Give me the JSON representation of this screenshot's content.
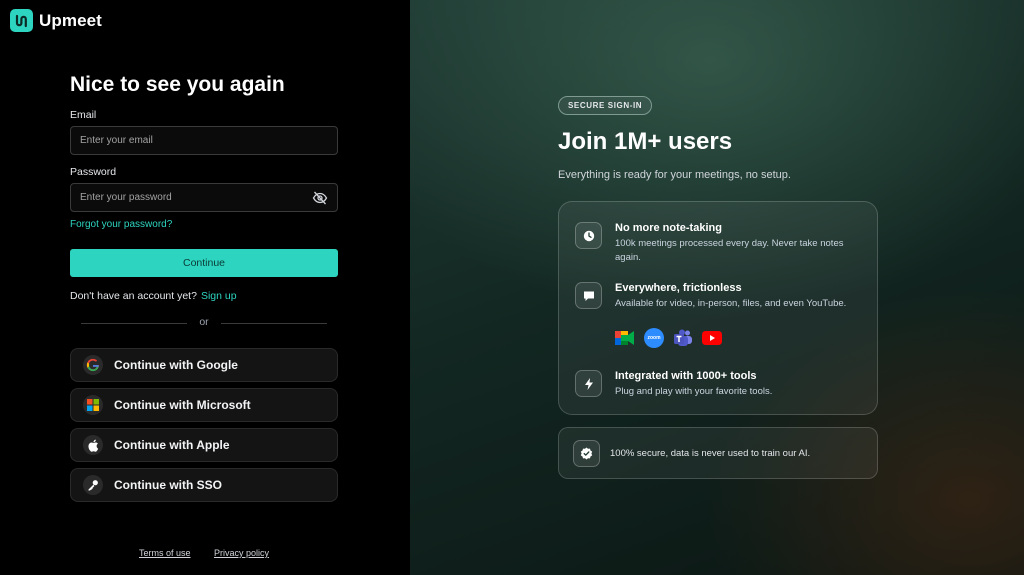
{
  "brand": {
    "name": "Upmeet",
    "accent": "#2dd4bf"
  },
  "login": {
    "title": "Nice to see you again",
    "email_label": "Email",
    "email_placeholder": "Enter your email",
    "email_value": "",
    "password_label": "Password",
    "password_placeholder": "Enter your password",
    "password_value": "",
    "forgot": "Forgot your password?",
    "continue": "Continue",
    "no_account": "Don't have an account yet?",
    "sign_up": "Sign up",
    "or": "or",
    "social": [
      {
        "label": "Continue with Google",
        "icon": "google-icon"
      },
      {
        "label": "Continue with Microsoft",
        "icon": "microsoft-icon"
      },
      {
        "label": "Continue with Apple",
        "icon": "apple-icon"
      },
      {
        "label": "Continue with SSO",
        "icon": "key-icon"
      }
    ],
    "footer": {
      "terms": "Terms of use",
      "privacy": "Privacy policy"
    }
  },
  "promo": {
    "badge": "SECURE SIGN-IN",
    "title": "Join 1M+ users",
    "subtitle": "Everything is ready for your meetings, no setup.",
    "features": [
      {
        "title": "No more note-taking",
        "desc": "100k meetings processed every day. Never take notes again.",
        "icon": "clock-icon"
      },
      {
        "title": "Everywhere, frictionless",
        "desc": "Available for video, in-person, files, and even YouTube.",
        "icon": "chat-bubble-icon"
      },
      {
        "title": "Integrated with 1000+ tools",
        "desc": "Plug and play with your favorite tools.",
        "icon": "lightning-icon"
      }
    ],
    "apps": [
      "google-meet-icon",
      "zoom-icon",
      "teams-icon",
      "youtube-icon"
    ],
    "zoom_text": "zoom",
    "secure": "100% secure, data is never used to train our AI.",
    "secure_icon": "check-shield-icon"
  }
}
